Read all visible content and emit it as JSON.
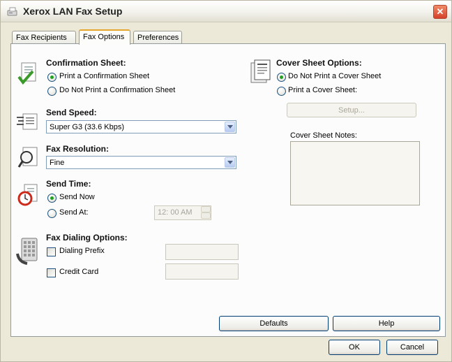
{
  "window": {
    "title": "Xerox LAN Fax Setup"
  },
  "tabs": [
    {
      "label": "Fax Recipients"
    },
    {
      "label": "Fax Options"
    },
    {
      "label": "Preferences"
    }
  ],
  "confirmation": {
    "heading": "Confirmation Sheet:",
    "options": [
      "Print a Confirmation Sheet",
      "Do Not Print a Confirmation Sheet"
    ],
    "selected": "Print a Confirmation Sheet"
  },
  "send_speed": {
    "heading": "Send Speed:",
    "value": "Super G3 (33.6 Kbps)"
  },
  "fax_resolution": {
    "heading": "Fax Resolution:",
    "value": "Fine"
  },
  "send_time": {
    "heading": "Send Time:",
    "options": [
      "Send Now",
      "Send At:"
    ],
    "selected": "Send Now",
    "time_value": "12: 00 AM"
  },
  "dialing": {
    "heading": "Fax Dialing Options:",
    "dialing_prefix": "Dialing Prefix",
    "credit_card": "Credit Card"
  },
  "cover_sheet": {
    "heading": "Cover Sheet Options:",
    "options": [
      "Do Not Print a Cover Sheet",
      "Print a Cover Sheet:"
    ],
    "selected": "Do Not Print a Cover Sheet",
    "setup_label": "Setup...",
    "notes_label": "Cover Sheet Notes:"
  },
  "buttons": {
    "defaults": "Defaults",
    "help": "Help",
    "ok": "OK",
    "cancel": "Cancel"
  },
  "colors": {
    "window_bg": "#ece9d8",
    "panel_bg": "#fcfcfc",
    "active_tab_accent": "#e6a52b",
    "radio_dot": "#21a121",
    "close_button": "#d6402a"
  }
}
